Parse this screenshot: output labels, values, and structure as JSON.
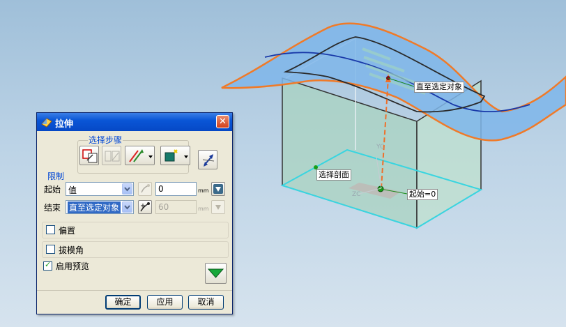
{
  "viewport": {
    "labels": {
      "until_selected": "直至选定对象",
      "select_section": "选择剖面",
      "start_zero": "起始=0"
    },
    "axes": {
      "yc": "YC",
      "zc": "ZC"
    }
  },
  "dialog": {
    "title": "拉伸",
    "close_symbol": "✕",
    "selection_steps": {
      "title": "选择步骤"
    },
    "limits": {
      "title": "限制",
      "start": {
        "label": "起始",
        "mode": "值",
        "value": "0",
        "unit": "mm"
      },
      "end": {
        "label": "结束",
        "mode": "直至选定对象",
        "value": "60",
        "unit": "mm"
      }
    },
    "offset": {
      "label": "偏置",
      "checked": false
    },
    "draft": {
      "label": "拔模角",
      "checked": false
    },
    "preview": {
      "label": "启用预览",
      "checked": true,
      "tick": "✓"
    },
    "buttons": {
      "ok": "确定",
      "apply": "应用",
      "cancel": "取消"
    }
  },
  "colors": {
    "title_bar": "#0a56d6",
    "surface": "#7fb6ea",
    "surface_edge": "#f07a28",
    "box_fill": "#b9dcc6",
    "section_edge": "#39d5e0",
    "extrude_vector": "#ef6f2a"
  }
}
